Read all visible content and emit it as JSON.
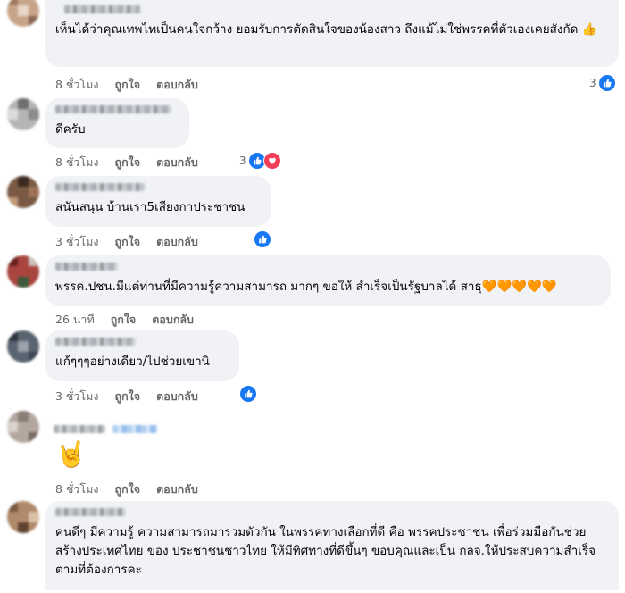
{
  "comments": [
    {
      "text": "เห็นได้ว่าคุณเทพไทเป็นคนใจกว้าง ยอมรับการตัดสินใจของน้องสาว ถึงแม้ไม่ใช่พรรคที่ตัวเองเคยสังกัด 👍",
      "time": "8 ชั่วโมง",
      "like": "ถูกใจ",
      "reply": "ตอบกลับ",
      "reaction_count": "3",
      "reactions": [
        "like"
      ]
    },
    {
      "text": "ดีครับ",
      "time": "8 ชั่วโมง",
      "like": "ถูกใจ",
      "reply": "ตอบกลับ",
      "reaction_count": "3",
      "reactions": [
        "like",
        "love"
      ]
    },
    {
      "text": "สนันสนุน บ้านเรา5เสียงกาประชาชน",
      "time": "3 ชั่วโมง",
      "like": "ถูกใจ",
      "reply": "ตอบกลับ",
      "reaction_count": "",
      "reactions": [
        "like"
      ]
    },
    {
      "text": "พรรค.ปชน.มีแต่ท่านที่มีความรู้ความสามารถ มากๆ ขอให้ สำเร็จเป็นรัฐบาลได้ สาธุ🧡🧡🧡🧡🧡",
      "time": "26 นาที",
      "like": "ถูกใจ",
      "reply": "ตอบกลับ",
      "reaction_count": "",
      "reactions": []
    },
    {
      "text": "แก้ๆๆๆอย่างเดียว/ไปช่วยเขานิ",
      "time": "3 ชั่วโมง",
      "like": "ถูกใจ",
      "reply": "ตอบกลับ",
      "reaction_count": "",
      "reactions": [
        "like"
      ]
    },
    {
      "text": "🤘",
      "time": "8 ชั่วโมง",
      "like": "ถูกใจ",
      "reply": "ตอบกลับ",
      "reaction_count": "",
      "reactions": []
    },
    {
      "text": "คนดีๆ มีความรู้ ความสามารถมารวมตัวกัน ในพรรคทางเลือกที่ดี คือ พรรคประชาชน เพื่อร่วมมือกันช่วยสร้างประเทศไทย ของ ประชาชนชาวไทย ให้มีทิศทางที่ดีขึ้นๆ ขอบคุณและเป็น กลจ.ให้ประสบความสำเร็จตามที่ต้องการคะ",
      "time": "",
      "like": "",
      "reply": "",
      "reaction_count": "",
      "reactions": []
    }
  ],
  "colors": {
    "like": "#1877f2",
    "love": "#f33e58",
    "bubble": "#f0f2f5",
    "meta": "#65676b"
  }
}
